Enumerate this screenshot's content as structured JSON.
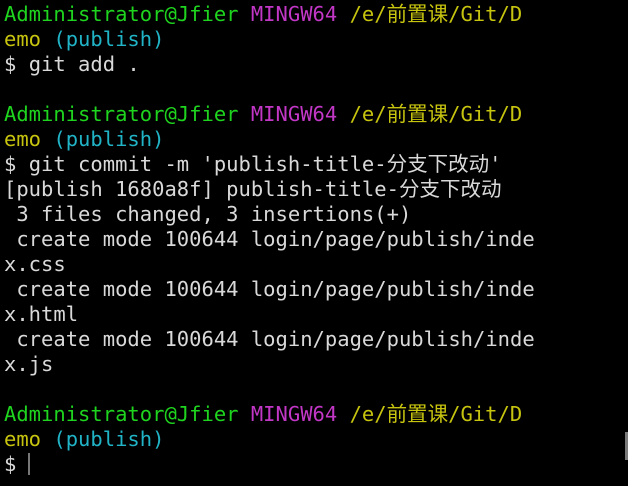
{
  "prompt": {
    "user": "Administrator@Jfier",
    "shell": "MINGW64",
    "path_line1": "/e/前置课/Git/D",
    "path_line2": "emo",
    "branch": "(publish)",
    "symbol": "$"
  },
  "commands": {
    "cmd1": "git add .",
    "cmd2": "git commit -m 'publish-title-分支下改动'"
  },
  "output": {
    "commit_line": "[publish 1680a8f] publish-title-分支下改动",
    "summary": " 3 files changed, 3 insertions(+)",
    "file1_a": " create mode 100644 login/page/publish/inde",
    "file1_b": "x.css",
    "file2_a": " create mode 100644 login/page/publish/inde",
    "file2_b": "x.html",
    "file3_a": " create mode 100644 login/page/publish/inde",
    "file3_b": "x.js"
  }
}
